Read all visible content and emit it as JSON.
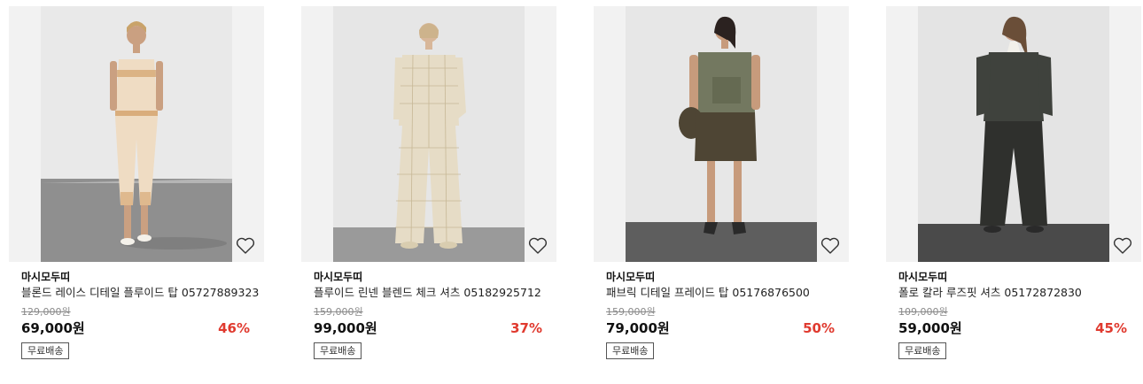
{
  "products": [
    {
      "brand": "마시모두띠",
      "name": "블론드 레이스 디테일 플루이드 탑 05727889323",
      "original_price": "129,000원",
      "price": "69,000원",
      "discount": "46%",
      "shipping_badge": "무료배송",
      "wishlist_icon": "heart-outline-icon",
      "photo_colors": {
        "wall": "#e9e9e9",
        "floor": "#8f8f8f",
        "garment": "#efdcc3",
        "accent": "#d3a16a"
      }
    },
    {
      "brand": "마시모두띠",
      "name": "플루이드 린넨 블렌드 체크 셔츠 05182925712",
      "original_price": "159,000원",
      "price": "99,000원",
      "discount": "37%",
      "shipping_badge": "무료배송",
      "wishlist_icon": "heart-outline-icon",
      "photo_colors": {
        "wall": "#e6e6e6",
        "floor": "#9a9a9a",
        "garment": "#e6dcc6",
        "accent": "#bfae8a"
      }
    },
    {
      "brand": "마시모두띠",
      "name": "패브릭 디테일 프레이드 탑 05176876500",
      "original_price": "159,000원",
      "price": "79,000원",
      "discount": "50%",
      "shipping_badge": "무료배송",
      "wishlist_icon": "heart-outline-icon",
      "photo_colors": {
        "wall": "#e7e7e7",
        "floor": "#5e5e5e",
        "garment": "#737860",
        "accent": "#4e4534"
      }
    },
    {
      "brand": "마시모두띠",
      "name": "폴로 칼라 루즈핏 셔츠 05172872830",
      "original_price": "109,000원",
      "price": "59,000원",
      "discount": "45%",
      "shipping_badge": "무료배송",
      "wishlist_icon": "heart-outline-icon",
      "photo_colors": {
        "wall": "#e4e4e4",
        "floor": "#4a4a4a",
        "garment": "#3f423d",
        "accent": "#f2f0ea"
      }
    }
  ],
  "colors": {
    "discount": "#e03a2f",
    "text": "#111111",
    "strike": "#8a8a8a"
  }
}
